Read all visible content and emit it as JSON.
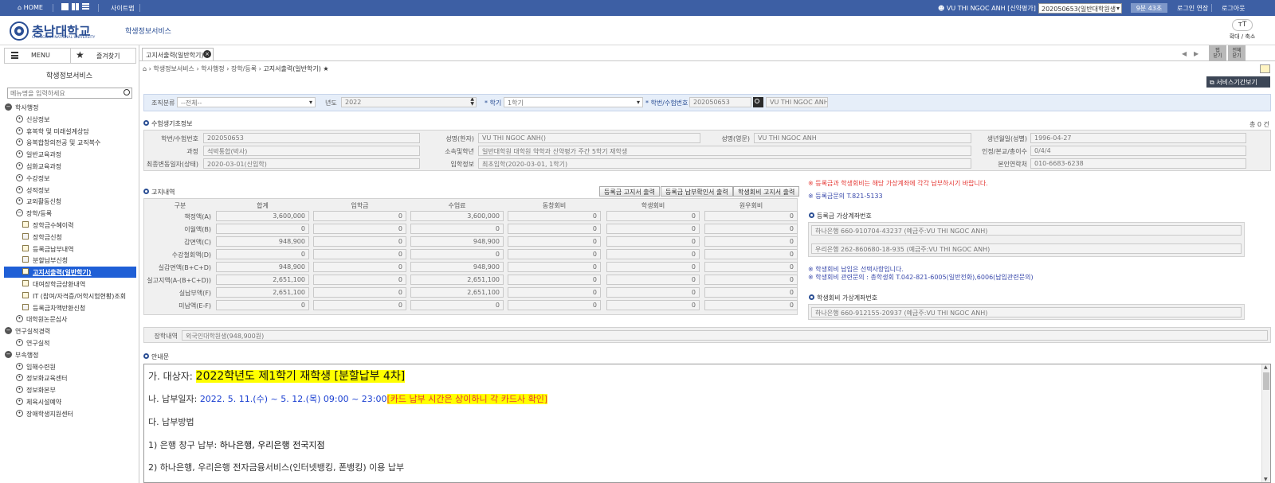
{
  "topbar": {
    "home": "HOME",
    "sitemap": "사이트맵",
    "user": "VU  THI NGOC ANH [신약평가]",
    "role_select": "202050653(일반대학원생",
    "timer": "9분 43초",
    "extend": "로그인 연장",
    "logout": "로그아웃"
  },
  "header": {
    "logo_ko": "충남대학교",
    "logo_en": "CHUNGNAM NATIONAL UNIVERSITY",
    "service": "학생정보서비스",
    "zoom_glyph": "ᴛT",
    "zoom_label": "확대 / 축소"
  },
  "sidebar": {
    "menu": "MENU",
    "favorites": "즐겨찾기",
    "title": "학생정보서비스",
    "search_placeholder": "메뉴명을 입력하세요",
    "items": [
      {
        "label": "학사행정",
        "level": 0,
        "icon": "minus"
      },
      {
        "label": "신상정보",
        "level": 1,
        "icon": "plus"
      },
      {
        "label": "휴복학 및 미래설계상담",
        "level": 1,
        "icon": "plus"
      },
      {
        "label": "융복합창의전공 및 교직복수",
        "level": 1,
        "icon": "plus"
      },
      {
        "label": "일반교육과정",
        "level": 1,
        "icon": "plus"
      },
      {
        "label": "심화교육과정",
        "level": 1,
        "icon": "plus"
      },
      {
        "label": "수강정보",
        "level": 1,
        "icon": "plus"
      },
      {
        "label": "성적정보",
        "level": 1,
        "icon": "plus"
      },
      {
        "label": "교외활동신청",
        "level": 1,
        "icon": "plus"
      },
      {
        "label": "장학/등록",
        "level": 1,
        "icon": "minus"
      },
      {
        "label": "장학금수혜이력",
        "level": 2,
        "icon": "doc"
      },
      {
        "label": "장학금신청",
        "level": 2,
        "icon": "edit"
      },
      {
        "label": "등록금납부내역",
        "level": 2,
        "icon": "doc"
      },
      {
        "label": "분할납부신청",
        "level": 2,
        "icon": "edit"
      },
      {
        "label": "고지서출력(일반학기)",
        "level": 2,
        "icon": "doc",
        "active": true
      },
      {
        "label": "대여장학금상환내역",
        "level": 2,
        "icon": "doc"
      },
      {
        "label": "IT (참여/자격증/어학시험현황)조회",
        "level": 2,
        "icon": "doc"
      },
      {
        "label": "등록금차액반환신청",
        "level": 2,
        "icon": "edit"
      },
      {
        "label": "대학원논문심사",
        "level": 1,
        "icon": "plus"
      },
      {
        "label": "연구실적경력",
        "level": 0,
        "icon": "minus"
      },
      {
        "label": "연구실적",
        "level": 1,
        "icon": "plus"
      },
      {
        "label": "부속행정",
        "level": 0,
        "icon": "minus"
      },
      {
        "label": "임해수련원",
        "level": 1,
        "icon": "plus"
      },
      {
        "label": "정보화교육센터",
        "level": 1,
        "icon": "plus"
      },
      {
        "label": "정보화본부",
        "level": 1,
        "icon": "plus"
      },
      {
        "label": "체육시설예약",
        "level": 1,
        "icon": "plus"
      },
      {
        "label": "장애학생지원센터",
        "level": 1,
        "icon": "plus"
      }
    ]
  },
  "tabs": [
    {
      "label": "고지서출력(일반학기)"
    }
  ],
  "right_tools": {
    "tab_close_all": "탭\n닫기",
    "full_screen": "전체\n닫기"
  },
  "breadcrumb": [
    "학생정보서비스",
    "학사행정",
    "장학/등록",
    "고지서출력(일반학기)"
  ],
  "service_period_btn": "서비스기간보기",
  "search": {
    "org_label": "조직분류",
    "org_value": "--전체--",
    "year_label": "년도",
    "year_value": "2022",
    "term_label": "학기",
    "term_value": "1학기",
    "id_label": "학번/수험번호",
    "id_value": "202050653",
    "name_value": "VU  THI NGOC ANH"
  },
  "student_info": {
    "title": "수험생기초정보",
    "total": "총 0 건",
    "rows": [
      [
        {
          "label": "학번/수험번호",
          "value": "202050653"
        },
        {
          "label": "성명(한자)",
          "value": "VU  THI NGOC ANH()"
        },
        {
          "label": "성명(영문)",
          "value": "VU  THI NGOC ANH"
        },
        {
          "label": "생년월일(성별)",
          "value": "1996-04-27"
        }
      ],
      [
        {
          "label": "과정",
          "value": "석박통합(박사)"
        },
        {
          "label": "소속및학년",
          "value": "일반대학원 대학원 약학과 신약평가 주간 5학기 재학생"
        },
        {
          "label": "인정/본교/총이수",
          "value": "0/4/4"
        }
      ],
      [
        {
          "label": "최종변동일자(상태)",
          "value": "2020-03-01(신입학)"
        },
        {
          "label": "입학정보",
          "value": "최초입학(2020-03-01, 1학기)"
        },
        {
          "label": "본인연락처",
          "value": "010-6683-6238"
        }
      ]
    ]
  },
  "notice": {
    "title": "고지내역",
    "buttons": [
      "등록금 고지서 출력",
      "등록금 납부확인서 출력",
      "학생회비 고지서 출력"
    ],
    "columns": [
      "구분",
      "합계",
      "입학금",
      "수업료",
      "동창회비",
      "학생회비",
      "원우회비"
    ],
    "rows": [
      {
        "label": "책정액(A)",
        "values": [
          "3,600,000",
          "0",
          "3,600,000",
          "0",
          "0",
          "0"
        ]
      },
      {
        "label": "이월액(B)",
        "values": [
          "0",
          "0",
          "0",
          "0",
          "0",
          "0"
        ]
      },
      {
        "label": "감면액(C)",
        "values": [
          "948,900",
          "0",
          "948,900",
          "0",
          "0",
          "0"
        ]
      },
      {
        "label": "수강철회액(D)",
        "values": [
          "0",
          "0",
          "0",
          "0",
          "0",
          "0"
        ]
      },
      {
        "label": "실감면액(B+C+D)",
        "values": [
          "948,900",
          "0",
          "948,900",
          "0",
          "0",
          "0"
        ]
      },
      {
        "label": "실고지액(A-(B+C+D))",
        "values": [
          "2,651,100",
          "0",
          "2,651,100",
          "0",
          "0",
          "0"
        ]
      },
      {
        "label": "실납부액(F)",
        "values": [
          "2,651,100",
          "0",
          "2,651,100",
          "0",
          "0",
          "0"
        ]
      },
      {
        "label": "미납액(E-F)",
        "values": [
          "0",
          "0",
          "0",
          "0",
          "0",
          "0"
        ]
      }
    ]
  },
  "right_panel": {
    "warn": "※ 등록금과 학생회비는 해당 가상계좌에 각각 납부하시기 바랍니다.",
    "contact1": "※ 등록금문의 T.821-5133",
    "tuition_acct_title": "등록금 가상계좌번호",
    "tuition_accts": [
      "하나은행 660-910704-43237 (예금주:VU  THI NGOC ANH)",
      "우리은행 262-860680-18-935 (예금주:VU  THI NGOC ANH)"
    ],
    "note1": "※ 학생회비 납입은 선택사항입니다.",
    "note2": "※ 학생회비 관련문의 : 총학생회 T.042-821-6005(일반전화),6006(납입관련문의)",
    "council_acct_title": "학생회비 가상계좌번호",
    "council_acct": "하나은행 660-912155-20937 (예금주:VU  THI NGOC ANH)"
  },
  "scholarship": {
    "label": "장학내역",
    "value": "외국인대학원생(948,900원)"
  },
  "guide": {
    "title": "안내문",
    "line1_prefix": "가. 대상자:",
    "line1_highlight": "2022학년도 제1학기 재학생 [분할납부 4차]",
    "line2_prefix": "나.  납부일자:",
    "line2_date": "2022. 5. 11.(수) ~ 5. 12.(목) 09:00 ~ 23:00",
    "line2_note": "[카드 납부 시간은 상이하니 각 카드사 확인]",
    "line3": "다. 납부방법",
    "line4_prefix": " 1) 은행 창구 납부:",
    "line4_value": "하나은행, 우리은행 전국지점",
    "line5": " 2) 하나은행, 우리은행 전자금융서비스(인터넷뱅킹, 폰뱅킹) 이용 납부"
  },
  "colors": {
    "topbar": "#3d5fa4",
    "accent": "#2a4e94",
    "active_menu": "#1f5fd6",
    "highlight": "#ffff00",
    "warn": "#e53935",
    "link": "#3949ab"
  }
}
